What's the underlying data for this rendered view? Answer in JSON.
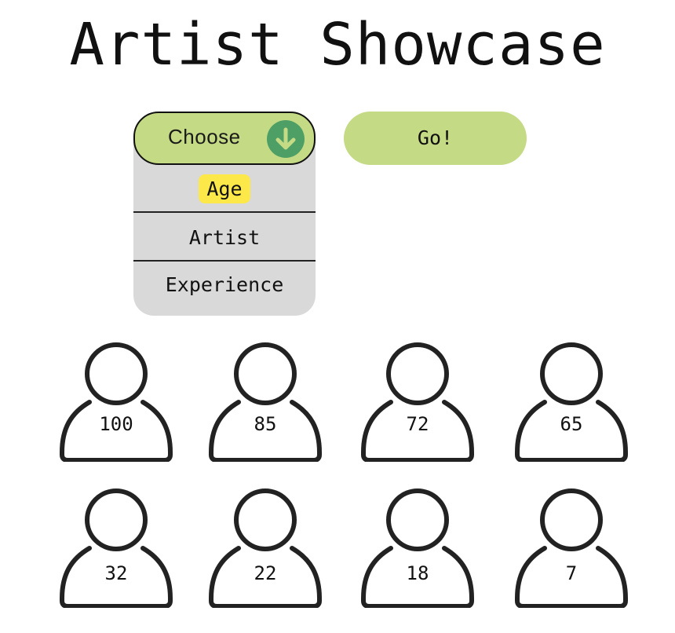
{
  "title": "Artist Showcase",
  "dropdown": {
    "label": "Choose",
    "icon": "arrow-down-circle-icon",
    "options": [
      "Age",
      "Artist",
      "Experience"
    ],
    "highlighted_option": "Age"
  },
  "go_button": {
    "label": "Go!"
  },
  "people": [
    {
      "value": "100"
    },
    {
      "value": "85"
    },
    {
      "value": "72"
    },
    {
      "value": "65"
    },
    {
      "value": "32"
    },
    {
      "value": "22"
    },
    {
      "value": "18"
    },
    {
      "value": "7"
    }
  ],
  "colors": {
    "button_green": "#c4da84",
    "icon_green": "#4e9f66",
    "dropdown_gray": "#d9d9d9",
    "highlight_yellow": "#fde84a",
    "outline": "#222222"
  }
}
